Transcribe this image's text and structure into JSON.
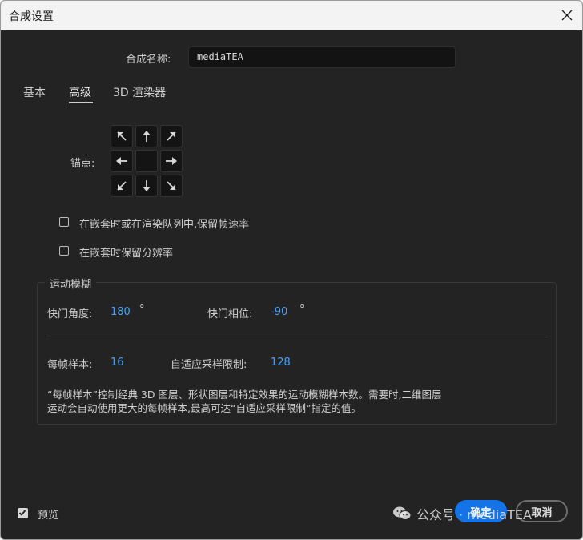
{
  "window": {
    "title": "合成设置"
  },
  "composition_name": {
    "label": "合成名称:",
    "value": "mediaTEA"
  },
  "tabs": [
    {
      "label": "基本",
      "active": false
    },
    {
      "label": "高级",
      "active": true
    },
    {
      "label": "3D 渲染器",
      "active": false
    }
  ],
  "anchor": {
    "label": "锚点:",
    "grid": [
      "arrow-up-left-icon",
      "arrow-up-icon",
      "arrow-up-right-icon",
      "arrow-left-icon",
      "center",
      "arrow-right-icon",
      "arrow-down-left-icon",
      "arrow-down-icon",
      "arrow-down-right-icon"
    ]
  },
  "options": [
    {
      "label": "在嵌套时或在渲染队列中,保留帧速率",
      "checked": false
    },
    {
      "label": "在嵌套时保留分辨率",
      "checked": false
    }
  ],
  "motion_blur": {
    "legend": "运动模糊",
    "shutter_angle": {
      "label": "快门角度:",
      "value": "180",
      "unit": "°"
    },
    "shutter_phase": {
      "label": "快门相位:",
      "value": "-90",
      "unit": "°"
    },
    "samples_per_frame": {
      "label": "每帧样本:",
      "value": "16"
    },
    "adaptive_sample_limit": {
      "label": "自适应采样限制:",
      "value": "128"
    },
    "description_line1": "“每帧样本”控制经典 3D 图层、形状图层和特定效果的运动模糊样本数。需要时,二维图层",
    "description_line2": "运动会自动使用更大的每帧样本,最高可达“自适应采样限制”指定的值。"
  },
  "footer": {
    "preview_label": "预览",
    "preview_checked": true,
    "ok_label": "确定",
    "cancel_label": "取消"
  },
  "watermark": {
    "text": "公众号 · mediaTEA"
  },
  "colors": {
    "accent": "#1473e6",
    "value_link": "#4ea1f3",
    "background": "#232323"
  }
}
